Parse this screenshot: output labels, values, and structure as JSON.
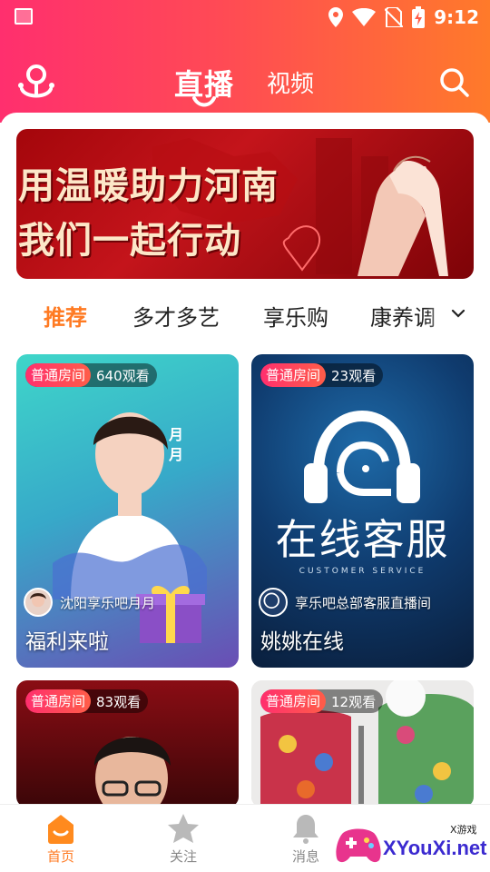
{
  "status_bar": {
    "time": "9:12"
  },
  "top_tabs": {
    "live": "直播",
    "video": "视频"
  },
  "banner": {
    "line1": "用温暖助力河南",
    "line2": "我们一起行动"
  },
  "categories": [
    "推荐",
    "多才多艺",
    "享乐购",
    "康养调"
  ],
  "cards": [
    {
      "type": "普通房间",
      "views": "640观看",
      "host": "沈阳享乐吧月月",
      "title": "福利来啦",
      "overlay": [
        "月",
        "月"
      ]
    },
    {
      "type": "普通房间",
      "views": "23观看",
      "host": "享乐吧总部客服直播间",
      "title": "姚姚在线",
      "overlay_text": "在线客服",
      "overlay_sub": "CUSTOMER SERVICE"
    },
    {
      "type": "普通房间",
      "views": "83观看"
    },
    {
      "type": "普通房间",
      "views": "12观看"
    }
  ],
  "bottom_nav": [
    {
      "label": "首页",
      "icon": "home-icon",
      "active": true
    },
    {
      "label": "关注",
      "icon": "star-icon",
      "active": false
    },
    {
      "label": "消息",
      "icon": "bell-icon",
      "active": false
    }
  ],
  "watermark": {
    "text": "XYouXi.net",
    "tag": "X游戏"
  },
  "colors": {
    "accent": "#ff7a22",
    "header_start": "#ff2f6e",
    "header_end": "#ff7a2a"
  }
}
